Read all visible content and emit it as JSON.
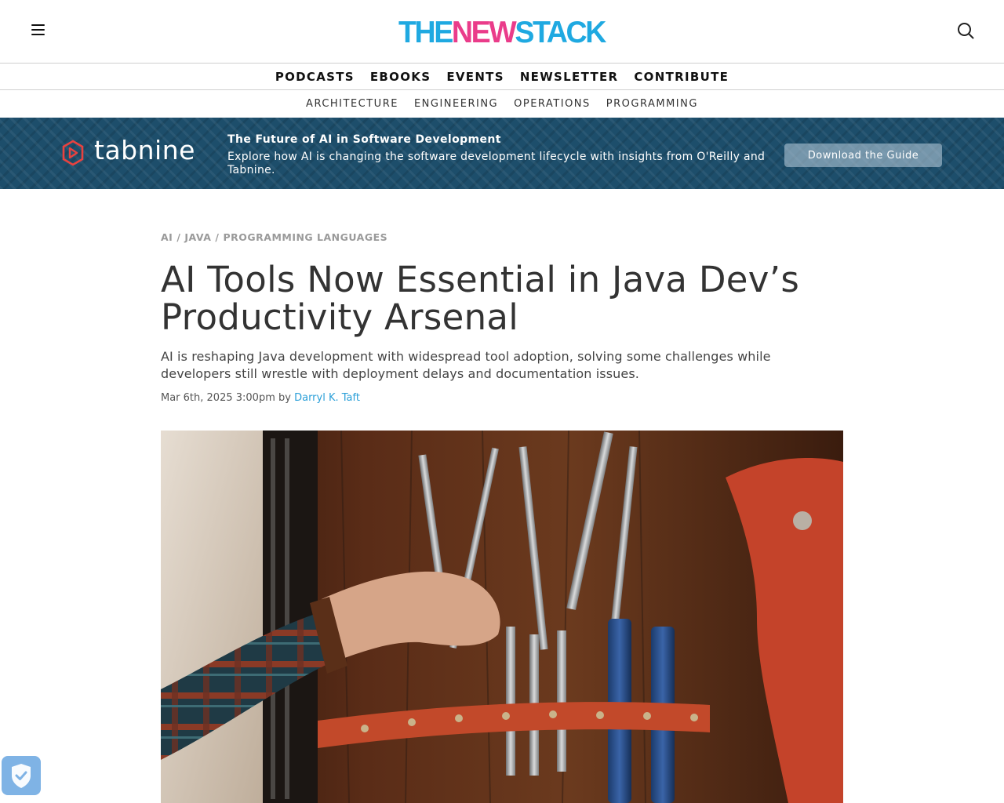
{
  "header": {
    "logo_parts": {
      "the": "THE",
      "new": "NEW",
      "stack": "STACK"
    },
    "menu_icon": "hamburger-menu-icon",
    "search_icon": "search-icon",
    "brand_colors": {
      "cyan": "#1fa9e1",
      "magenta": "#ea3c8a"
    }
  },
  "primary_nav": [
    "PODCASTS",
    "EBOOKS",
    "EVENTS",
    "NEWSLETTER",
    "CONTRIBUTE"
  ],
  "secondary_nav": [
    "ARCHITECTURE",
    "ENGINEERING",
    "OPERATIONS",
    "PROGRAMMING"
  ],
  "banner": {
    "brand": "tabnine",
    "title": "The Future of AI in Software Development",
    "description": "Explore how AI is changing the software development lifecycle with insights from O'Reilly and Tabnine.",
    "cta": "Download the Guide",
    "colors": {
      "background": "#1d4e6b",
      "logo_mark": "#e8423f"
    }
  },
  "article": {
    "categories": [
      "AI",
      "JAVA",
      "PROGRAMMING LANGUAGES"
    ],
    "category_separator": "/",
    "title": "AI Tools Now Essential in Java Dev’s Productivity Arsenal",
    "dek": "AI is reshaping Java development with widespread tool adoption, solving some challenges while developers still wrestle with deployment delays and documentation issues.",
    "date": "Mar 6th, 2025 3:00pm",
    "by": "by",
    "author": "Darryl K. Taft",
    "author_color": "#2a9fd8"
  },
  "privacy_badge_icon": "shield-check-icon"
}
